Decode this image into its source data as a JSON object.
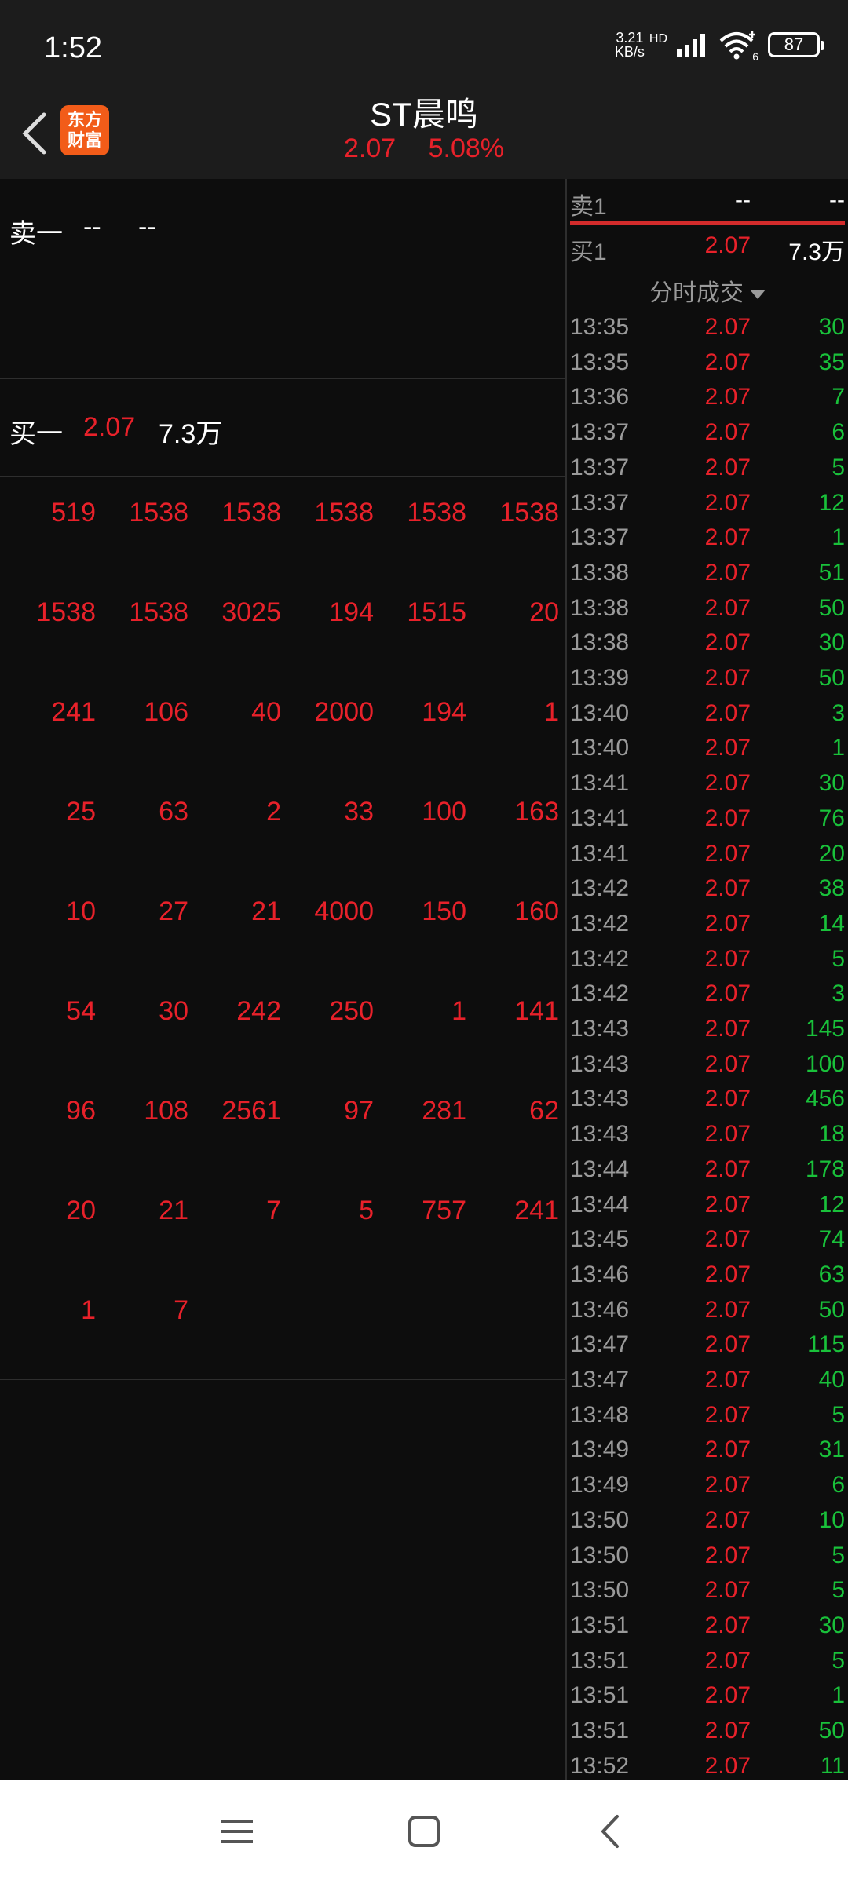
{
  "status_bar": {
    "time": "1:52",
    "speed_value": "3.21",
    "speed_unit": "KB/s",
    "hd": "HD",
    "wifi_badge": "6",
    "battery": "87"
  },
  "header": {
    "logo_line1": "东方",
    "logo_line2": "财富",
    "title": "ST晨鸣",
    "price": "2.07",
    "change_pct": "5.08%"
  },
  "order_book": {
    "sell1": {
      "label": "卖一",
      "price": "--",
      "volume": "--"
    },
    "buy1": {
      "label": "买一",
      "price": "2.07",
      "volume": "7.3万"
    }
  },
  "queue_grid": [
    [
      "519",
      "1538",
      "1538",
      "1538",
      "1538",
      "1538"
    ],
    [
      "1538",
      "1538",
      "3025",
      "194",
      "1515",
      "20"
    ],
    [
      "241",
      "106",
      "40",
      "2000",
      "194",
      "1"
    ],
    [
      "25",
      "63",
      "2",
      "33",
      "100",
      "163"
    ],
    [
      "10",
      "27",
      "21",
      "4000",
      "150",
      "160"
    ],
    [
      "54",
      "30",
      "242",
      "250",
      "1",
      "141"
    ],
    [
      "96",
      "108",
      "2561",
      "97",
      "281",
      "62"
    ],
    [
      "20",
      "21",
      "7",
      "5",
      "757",
      "241"
    ],
    [
      "1",
      "7"
    ]
  ],
  "side_quote": {
    "sell1": {
      "label": "卖1",
      "price": "--",
      "volume": "--"
    },
    "buy1": {
      "label": "买1",
      "price": "2.07",
      "volume": "7.3万"
    },
    "dropdown_label": "分时成交"
  },
  "ticks": [
    [
      "13:35",
      "2.07",
      "30"
    ],
    [
      "13:35",
      "2.07",
      "35"
    ],
    [
      "13:36",
      "2.07",
      "7"
    ],
    [
      "13:37",
      "2.07",
      "6"
    ],
    [
      "13:37",
      "2.07",
      "5"
    ],
    [
      "13:37",
      "2.07",
      "12"
    ],
    [
      "13:37",
      "2.07",
      "1"
    ],
    [
      "13:38",
      "2.07",
      "51"
    ],
    [
      "13:38",
      "2.07",
      "50"
    ],
    [
      "13:38",
      "2.07",
      "30"
    ],
    [
      "13:39",
      "2.07",
      "50"
    ],
    [
      "13:40",
      "2.07",
      "3"
    ],
    [
      "13:40",
      "2.07",
      "1"
    ],
    [
      "13:41",
      "2.07",
      "30"
    ],
    [
      "13:41",
      "2.07",
      "76"
    ],
    [
      "13:41",
      "2.07",
      "20"
    ],
    [
      "13:42",
      "2.07",
      "38"
    ],
    [
      "13:42",
      "2.07",
      "14"
    ],
    [
      "13:42",
      "2.07",
      "5"
    ],
    [
      "13:42",
      "2.07",
      "3"
    ],
    [
      "13:43",
      "2.07",
      "145"
    ],
    [
      "13:43",
      "2.07",
      "100"
    ],
    [
      "13:43",
      "2.07",
      "456"
    ],
    [
      "13:43",
      "2.07",
      "18"
    ],
    [
      "13:44",
      "2.07",
      "178"
    ],
    [
      "13:44",
      "2.07",
      "12"
    ],
    [
      "13:45",
      "2.07",
      "74"
    ],
    [
      "13:46",
      "2.07",
      "63"
    ],
    [
      "13:46",
      "2.07",
      "50"
    ],
    [
      "13:47",
      "2.07",
      "115"
    ],
    [
      "13:47",
      "2.07",
      "40"
    ],
    [
      "13:48",
      "2.07",
      "5"
    ],
    [
      "13:49",
      "2.07",
      "31"
    ],
    [
      "13:49",
      "2.07",
      "6"
    ],
    [
      "13:50",
      "2.07",
      "10"
    ],
    [
      "13:50",
      "2.07",
      "5"
    ],
    [
      "13:50",
      "2.07",
      "5"
    ],
    [
      "13:51",
      "2.07",
      "30"
    ],
    [
      "13:51",
      "2.07",
      "5"
    ],
    [
      "13:51",
      "2.07",
      "1"
    ],
    [
      "13:51",
      "2.07",
      "50"
    ],
    [
      "13:52",
      "2.07",
      "11"
    ]
  ],
  "colors": {
    "up": "#e8212a",
    "buy_volume": "#19c13a",
    "background": "#0d0d0d",
    "header_bg": "#1c1c1c",
    "logo": "#f25c19"
  },
  "nav": {
    "menu_icon": "menu-icon",
    "home_icon": "home-square-icon",
    "back_icon": "back-chevron-icon"
  }
}
